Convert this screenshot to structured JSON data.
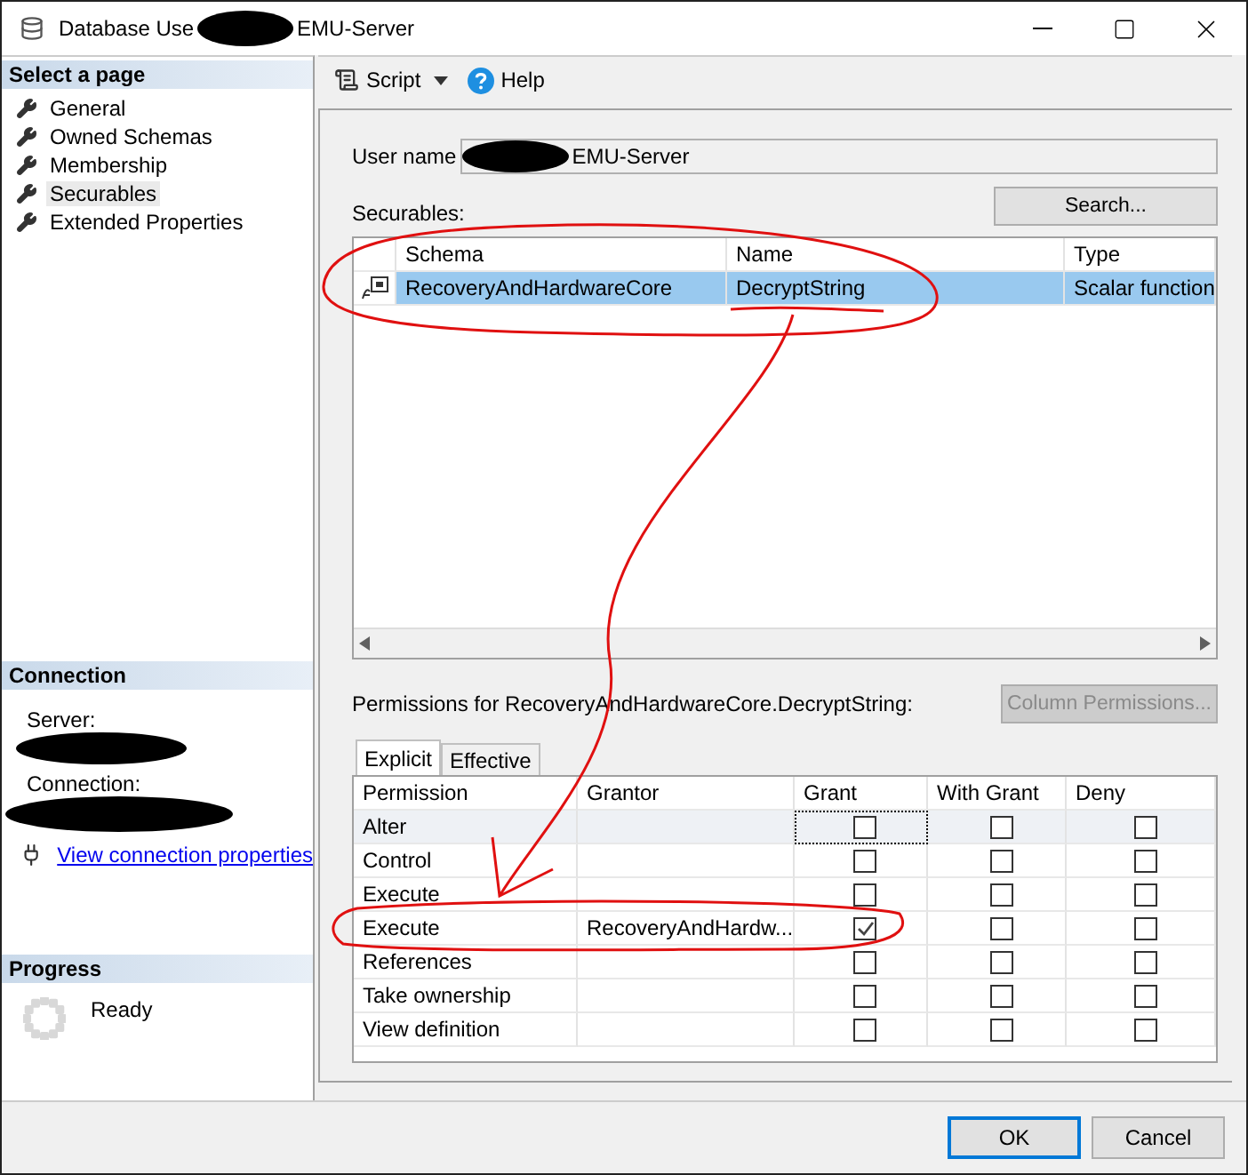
{
  "window": {
    "title_start": "Database Use",
    "title_end": "EMU-Server",
    "redacted": true
  },
  "sidebar": {
    "select_header": "Select a page",
    "pages": [
      {
        "label": "General",
        "selected": false
      },
      {
        "label": "Owned Schemas",
        "selected": false
      },
      {
        "label": "Membership",
        "selected": false
      },
      {
        "label": "Securables",
        "selected": true
      },
      {
        "label": "Extended Properties",
        "selected": false
      }
    ],
    "connection_header": "Connection",
    "server_label": "Server:",
    "connection_label": "Connection:",
    "redacted": true,
    "link": "View connection properties",
    "progress_header": "Progress",
    "progress_status": "Ready"
  },
  "toolbar": {
    "script": "Script",
    "help": "Help"
  },
  "user_name": {
    "label": "User name",
    "value_end": "EMU-Server",
    "redacted": true
  },
  "securables": {
    "label": "Securables:",
    "search_button": "Search...",
    "columns": [
      "Schema",
      "Name",
      "Type"
    ],
    "rows": [
      {
        "schema": "RecoveryAndHardwareCore",
        "name": "DecryptString",
        "type": "Scalar function",
        "selected": true
      }
    ]
  },
  "permissions": {
    "label": "Permissions for RecoveryAndHardwareCore.DecryptString:",
    "column_button": "Column Permissions...",
    "column_button_disabled": true,
    "tabs": [
      {
        "label": "Explicit",
        "selected": true
      },
      {
        "label": "Effective",
        "selected": false
      }
    ],
    "columns": [
      "Permission",
      "Grantor",
      "Grant",
      "With Grant",
      "Deny"
    ],
    "rows": [
      {
        "permission": "Alter",
        "selected": true,
        "grant": false,
        "with_grant": false,
        "deny": false
      },
      {
        "permission": "Control",
        "selected": false,
        "grant": false,
        "with_grant": false,
        "deny": false
      },
      {
        "permission": "Execute",
        "selected": false,
        "grant": false,
        "with_grant": false,
        "deny": false
      },
      {
        "permission": "Execute",
        "grantor": "RecoveryAndHardw...",
        "selected": false,
        "grant": true,
        "with_grant": false,
        "deny": false
      },
      {
        "permission": "References",
        "selected": false,
        "grant": false,
        "with_grant": false,
        "deny": false
      },
      {
        "permission": "Take ownership",
        "selected": false,
        "grant": false,
        "with_grant": false,
        "deny": false
      },
      {
        "permission": "View definition",
        "selected": false,
        "grant": false,
        "with_grant": false,
        "deny": false
      }
    ]
  },
  "buttons": [
    {
      "label": "OK",
      "default": true
    },
    {
      "label": "Cancel",
      "default": false
    }
  ],
  "annotations": {
    "shown": true
  }
}
